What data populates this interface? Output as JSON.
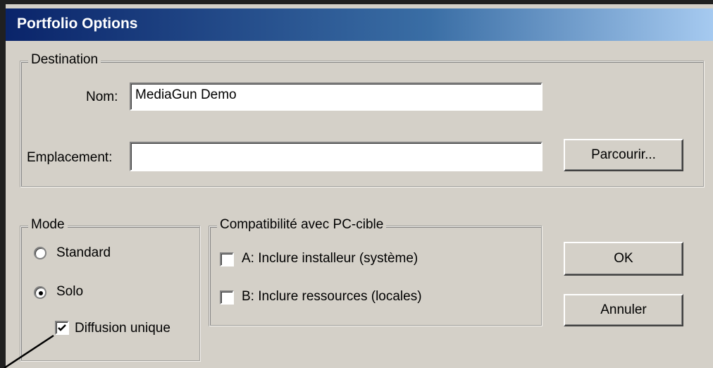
{
  "dialog": {
    "title": "Portfolio Options"
  },
  "destination": {
    "legend": "Destination",
    "nom_label": "Nom:",
    "nom_value": "MediaGun Demo",
    "emplacement_label": "Emplacement:",
    "emplacement_value": "",
    "browse_label": "Parcourir..."
  },
  "mode": {
    "legend": "Mode",
    "standard_label": "Standard",
    "solo_label": "Solo",
    "selected": "Solo",
    "diffusion_label": "Diffusion unique",
    "diffusion_checked": true
  },
  "compat": {
    "legend": "Compatibilité avec PC-cible",
    "option_a_label": "A: Inclure installeur (système)",
    "option_a_checked": false,
    "option_b_label": "B: Inclure ressources (locales)",
    "option_b_checked": false
  },
  "buttons": {
    "ok_label": "OK",
    "cancel_label": "Annuler"
  },
  "colors": {
    "face": "#d4d0c8",
    "title_start": "#0a246a",
    "title_end": "#a6caf0"
  }
}
